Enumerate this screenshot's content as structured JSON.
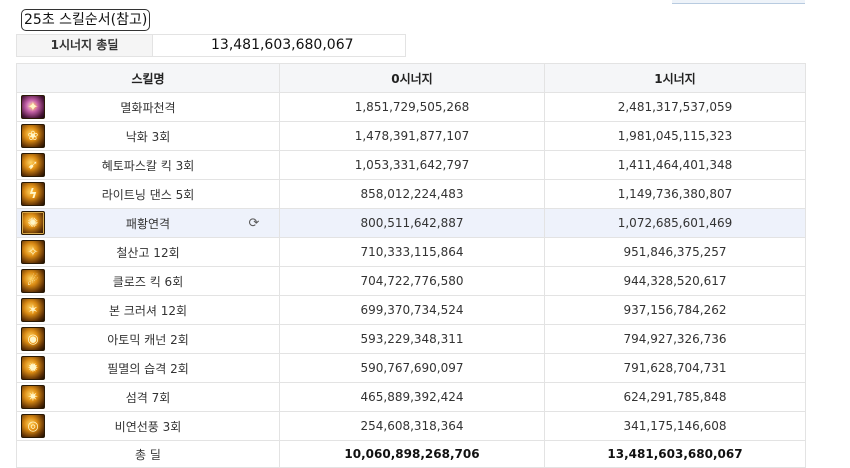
{
  "title": "25초 스킬순서(참고)",
  "summary": {
    "label": "1시너지 총딜",
    "value": "13,481,603,680,067"
  },
  "table": {
    "headers": [
      "스킬명",
      "0시너지",
      "1시너지"
    ],
    "rows": [
      {
        "name": "멸화파천격",
        "s0": "1,851,729,505,268",
        "s1": "2,481,317,537,059",
        "icon": "flame-burst-icon"
      },
      {
        "name": "낙화 3회",
        "s0": "1,478,391,877,107",
        "s1": "1,981,045,115,323",
        "icon": "falling-flower-icon"
      },
      {
        "name": "혜토파스칼 킥 3회",
        "s0": "1,053,331,642,797",
        "s1": "1,411,464,401,348",
        "icon": "kick-icon"
      },
      {
        "name": "라이트닝 댄스 5회",
        "s0": "858,012,224,483",
        "s1": "1,149,736,380,807",
        "icon": "lightning-dance-icon"
      },
      {
        "name": "패황연격",
        "s0": "800,511,642,887",
        "s1": "1,072,685,601,469",
        "icon": "combo-strike-icon",
        "highlight": true
      },
      {
        "name": "철산고 12회",
        "s0": "710,333,115,864",
        "s1": "951,846,375,257",
        "icon": "iron-mountain-icon"
      },
      {
        "name": "클로즈 킥 6회",
        "s0": "704,722,776,580",
        "s1": "944,328,520,617",
        "icon": "close-kick-icon"
      },
      {
        "name": "본 크러셔 12회",
        "s0": "699,370,734,524",
        "s1": "937,156,784,262",
        "icon": "bone-crusher-icon"
      },
      {
        "name": "아토믹 캐넌 2회",
        "s0": "593,229,348,311",
        "s1": "794,927,326,736",
        "icon": "atomic-cannon-icon"
      },
      {
        "name": "필멸의 습격 2회",
        "s0": "590,767,690,097",
        "s1": "791,628,704,731",
        "icon": "mortal-raid-icon"
      },
      {
        "name": "섬격 7회",
        "s0": "465,889,392,424",
        "s1": "624,291,785,848",
        "icon": "flash-strike-icon"
      },
      {
        "name": "비연선풍 3회",
        "s0": "254,608,318,364",
        "s1": "341,175,146,608",
        "icon": "whirlwind-icon"
      }
    ],
    "total": {
      "label": "총 딜",
      "s0": "10,060,898,268,706",
      "s1": "13,481,603,680,067"
    }
  }
}
